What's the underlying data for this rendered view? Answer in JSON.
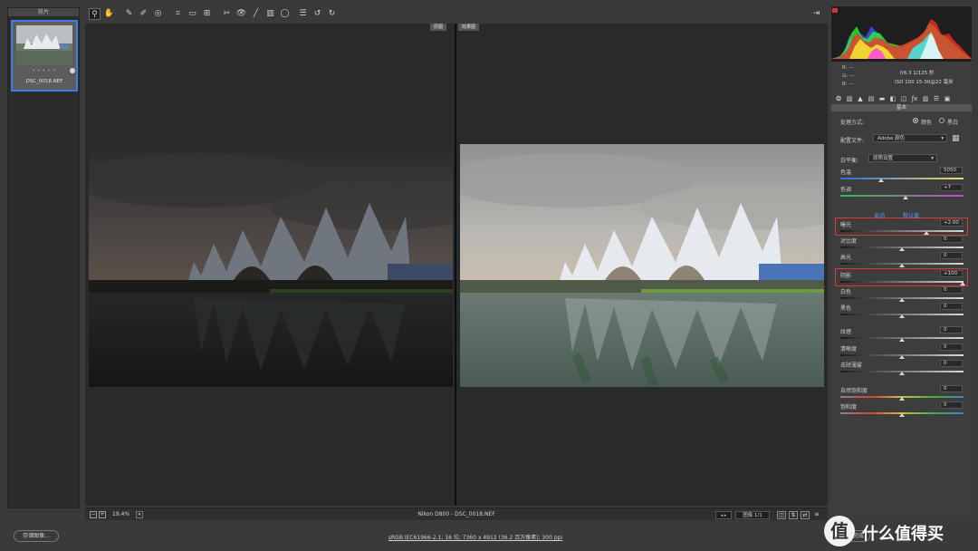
{
  "filmstrip": {
    "header": "胶片",
    "stars": "• • • • •",
    "filename": "DSC_0018.NEF"
  },
  "canvas": {
    "before_label": "原图",
    "after_label": "效果图"
  },
  "footer": {
    "zoom_out": "−",
    "zoom_in": "+",
    "zoom": "19.4%",
    "zoom_dropdown": "▾",
    "camera": "Nikon D800  -  DSC_0018.NEF",
    "nav": "◂ ▸",
    "count": "图像 1/1"
  },
  "histogram": {
    "colors": {
      "red": "#ff2a2a",
      "green": "#2aff2a",
      "blue": "#3a5bff",
      "yellow": "#ffff30",
      "cyan": "#30ffff",
      "magenta": "#ff30ff",
      "white": "#ffffff"
    }
  },
  "info": {
    "r": "R:  ---",
    "g": "G:  ---",
    "b": "B:  ---",
    "aperture_shutter": "f/6.3   1/125 秒",
    "iso_lens": "ISO 100   15-30@22 毫米"
  },
  "panel": {
    "title": "基本",
    "treatment_label": "处理方式:",
    "treatment_color": "颜色",
    "treatment_bw": "黑白",
    "profile_label": "配置文件:",
    "profile_value": "Adobe 颜色",
    "wb_label": "白平衡:",
    "wb_value": "原照设置",
    "auto": "自动",
    "default": "默认值",
    "sliders": [
      {
        "label": "色温",
        "value": "5050"
      },
      {
        "label": "色调",
        "value": "+7"
      },
      {
        "label": "曝光",
        "value": "+2.00"
      },
      {
        "label": "对比度",
        "value": "0"
      },
      {
        "label": "高光",
        "value": "0"
      },
      {
        "label": "阴影",
        "value": "+100"
      },
      {
        "label": "白色",
        "value": "0"
      },
      {
        "label": "黑色",
        "value": "0"
      },
      {
        "label": "纹理",
        "value": "0"
      },
      {
        "label": "清晰度",
        "value": "0"
      },
      {
        "label": "去除薄雾",
        "value": "0"
      },
      {
        "label": "自然饱和度",
        "value": "0"
      },
      {
        "label": "饱和度",
        "value": "0"
      }
    ]
  },
  "bottom": {
    "save": "存储图像...",
    "workflow": "sRGB IEC61966-2.1; 16 位; 7360 x 4912 (36.2 百万像素); 300 ppi",
    "done": "完成",
    "watermark": "什么值得买"
  }
}
